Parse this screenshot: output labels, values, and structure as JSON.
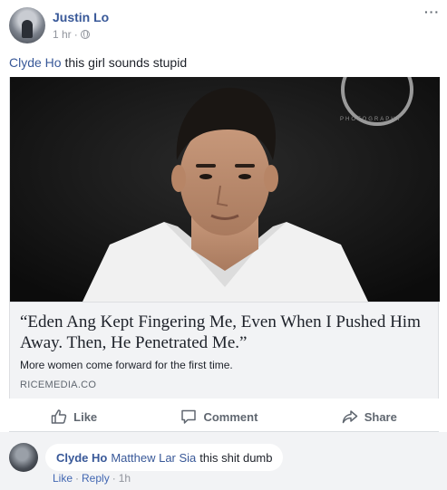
{
  "post": {
    "author": "Justin Lo",
    "time": "1 hr",
    "separator": "·",
    "more": "···",
    "status_tag": "Clyde Ho",
    "status_text": "this girl sounds stupid"
  },
  "link_card": {
    "watermark_brand": "PHOTOGRAPHY",
    "title": "“Eden Ang Kept Fingering Me, Even When I Pushed Him Away. Then, He Penetrated Me.”",
    "description": "More women come forward for the first time.",
    "source": "RICEMEDIA.CO"
  },
  "actions": {
    "like": "Like",
    "comment": "Comment",
    "share": "Share"
  },
  "comment": {
    "author": "Clyde Ho",
    "mention": "Matthew Lar Sia",
    "text": "this shit dumb",
    "like": "Like",
    "reply": "Reply",
    "sep": "·",
    "time": "1h"
  },
  "colors": {
    "link": "#385898",
    "meta": "#90949c",
    "action": "#606770",
    "card_bg": "#f2f3f5"
  }
}
